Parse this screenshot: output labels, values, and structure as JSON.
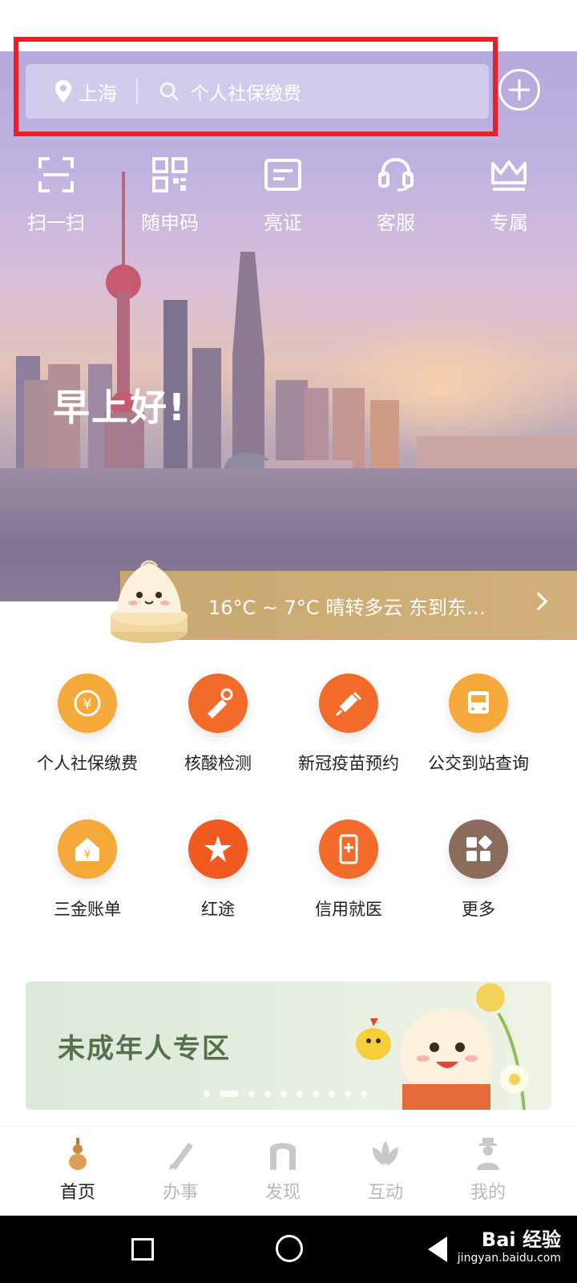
{
  "header": {
    "location": "上海",
    "search_placeholder": "个人社保缴费"
  },
  "quick_actions": [
    {
      "label": "扫一扫",
      "icon": "scan-icon"
    },
    {
      "label": "随申码",
      "icon": "qr-code-icon"
    },
    {
      "label": "亮证",
      "icon": "id-card-icon"
    },
    {
      "label": "客服",
      "icon": "headset-icon"
    },
    {
      "label": "专属",
      "icon": "crown-icon"
    }
  ],
  "greeting": "早上好!",
  "weather": "16°C ~ 7°C  晴转多云  东到东…",
  "services": [
    {
      "label": "个人社保缴费",
      "icon": "yen-clock-icon",
      "color": "#f6a93b"
    },
    {
      "label": "核酸检测",
      "icon": "dropper-icon",
      "color": "#f26b2a"
    },
    {
      "label": "新冠疫苗预约",
      "icon": "syringe-icon",
      "color": "#f26b2a"
    },
    {
      "label": "公交到站查询",
      "icon": "bus-icon",
      "color": "#f6a93b"
    },
    {
      "label": "三金账单",
      "icon": "house-yen-icon",
      "color": "#f6a93b"
    },
    {
      "label": "红途",
      "icon": "star-flag-icon",
      "color": "#f05a1e"
    },
    {
      "label": "信用就医",
      "icon": "phone-plus-icon",
      "color": "#f26b2a"
    },
    {
      "label": "更多",
      "icon": "grid-more-icon",
      "color": "#8a6b5c"
    }
  ],
  "banner": {
    "title": "未成年人专区"
  },
  "tabs": [
    {
      "label": "首页",
      "icon": "gourd-icon",
      "active": true
    },
    {
      "label": "办事",
      "icon": "pen-icon",
      "active": false
    },
    {
      "label": "发现",
      "icon": "arch-icon",
      "active": false
    },
    {
      "label": "互动",
      "icon": "lotus-icon",
      "active": false
    },
    {
      "label": "我的",
      "icon": "person-icon",
      "active": false
    }
  ],
  "watermark": {
    "main": "Bai 经验",
    "sub": "jingyan.baidu.com"
  }
}
